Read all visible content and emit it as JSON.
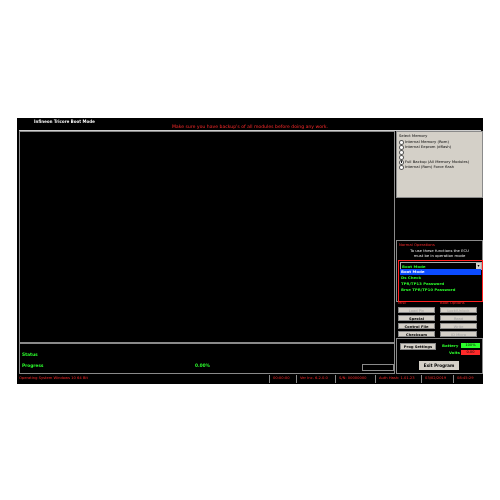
{
  "window": {
    "title": "Infineon Tricore Boot Mode"
  },
  "warning": "Make sure you have backup's of all modules before doing any work.",
  "memory": {
    "header": "Select Memory",
    "options": [
      {
        "label": "Internal Memory (Rom)",
        "selected": false
      },
      {
        "label": "Internal Eeprom (dflash)",
        "selected": false
      },
      {
        "label": "",
        "selected": false
      },
      {
        "label": "",
        "selected": false
      },
      {
        "label": "Full Backup (All Memory Modules)",
        "selected": true
      },
      {
        "label": "Internal (Rom) Force flash",
        "selected": false
      }
    ]
  },
  "normal_ops": {
    "header": "Normal Operations",
    "note1": "To use these functions the ECU",
    "note2": "must be in operation mode",
    "dropdown": {
      "value": "Boot Mode",
      "arrow": "▾",
      "options": [
        "Boot Mode",
        "Ds Check",
        "TPR/TP13 Password",
        "Brse TPR/TP10 Password"
      ],
      "selected_index": 0
    }
  },
  "misc": {
    "header": "Misc",
    "buttons": [
      {
        "label": "Load Pin",
        "enabled": false
      },
      {
        "label": "Special",
        "enabled": true
      },
      {
        "label": "Control File",
        "enabled": true
      },
      {
        "label": "Checksum",
        "enabled": true
      }
    ]
  },
  "boot_options": {
    "header": "Boot Options",
    "buttons": [
      {
        "label": "Lock/Unlock",
        "enabled": false
      },
      {
        "label": "Read",
        "enabled": false
      },
      {
        "label": "Write",
        "enabled": false
      },
      {
        "label": "ID Micro",
        "enabled": false
      }
    ]
  },
  "status": {
    "status_label": "Status",
    "progress_label": "Progress",
    "progress_value": "0.00%",
    "progress_fraction": 0.0
  },
  "meters": {
    "prog_settings": "Prog Settings",
    "battery_label": "Battery",
    "battery_value": "100%",
    "volts_label": "Volts",
    "volts_value": "0.00",
    "battery_color": "#2cff2c",
    "volts_color": "#ff2a2a"
  },
  "exit_label": "Exit Program",
  "bottom_bar": {
    "os": "Operating System Windows 10 64 Bit",
    "time1": "00:00:00",
    "version": "Ver Inc. 6.2.0.0",
    "serial": "S/N: 00000000",
    "auth": "Auth Hash: 1.01.23",
    "date": "03/02/2019",
    "clock": "08:45:29"
  },
  "colors": {
    "accent_red": "#ff2a2a",
    "accent_green": "#2cff2c",
    "select_blue": "#0b4bff"
  }
}
